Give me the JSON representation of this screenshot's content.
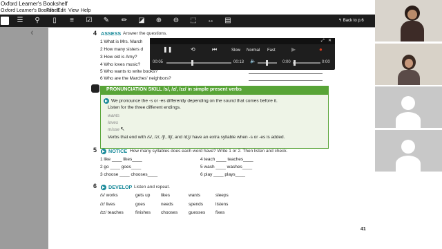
{
  "app": {
    "title": "Oxford Learner's Bookshelf",
    "menu": [
      "Oxford Learner's Bookshelf",
      "File",
      "Edit",
      "View",
      "Help"
    ],
    "back_label": "Back to p.6"
  },
  "sections": {
    "assess": {
      "number": "4",
      "heading": "ASSESS",
      "instruction": "Answer the questions.",
      "questions": [
        "1   What is Mrs. March",
        "2   How many sisters d",
        "3   How old is Amy?",
        "4   Who loves music?",
        "5   Who wants to write books?",
        "6   Who are the Marches' neighbors?"
      ]
    },
    "pronunciation": {
      "heading": "PRONUNCIATION SKILL /s/, /z/, /ɪz/ in simple present verbs",
      "intro_line1": "We pronounce the -s or -es differently depending on the sound that comes before it.",
      "intro_line2": "Listen for the three different endings.",
      "examples": [
        "wants",
        "loves",
        "misse"
      ],
      "rule": "Verbs that end with /s/, /z/, /ʃ/, /tʃ/, and /dʒ/ have an extra syllable when -s or -es is added."
    },
    "notice": {
      "number": "5",
      "heading": "NOTICE",
      "instruction": "How many syllables does each word have? Write 1 or 2. Then listen and check.",
      "items": [
        {
          "left": "1   like ____ likes____",
          "right": "4   teach ____ teaches____"
        },
        {
          "left": "2   go ____ goes____",
          "right": "5   wash ____ washes____"
        },
        {
          "left": "3   choose ____ chooses____",
          "right": "6   play ____ plays____"
        }
      ]
    },
    "develop": {
      "number": "6",
      "heading": "DEVELOP",
      "instruction": "Listen and repeat.",
      "rows": [
        [
          "/s/  works",
          "gets up",
          "likes",
          "wants",
          "sleeps"
        ],
        [
          "/z/  lives",
          "goes",
          "needs",
          "spends",
          "listens"
        ],
        [
          "/ɪz/  teaches",
          "finishes",
          "chooses",
          "guesses",
          "fixes"
        ]
      ]
    }
  },
  "page_number": "41",
  "player": {
    "controls": [
      "Slow",
      "Normal",
      "Fast"
    ],
    "elapsed": "00:05",
    "total": "00:13",
    "clip_start": "0:00",
    "clip_end": "0:00",
    "progress": 0.38
  },
  "participants": 4
}
